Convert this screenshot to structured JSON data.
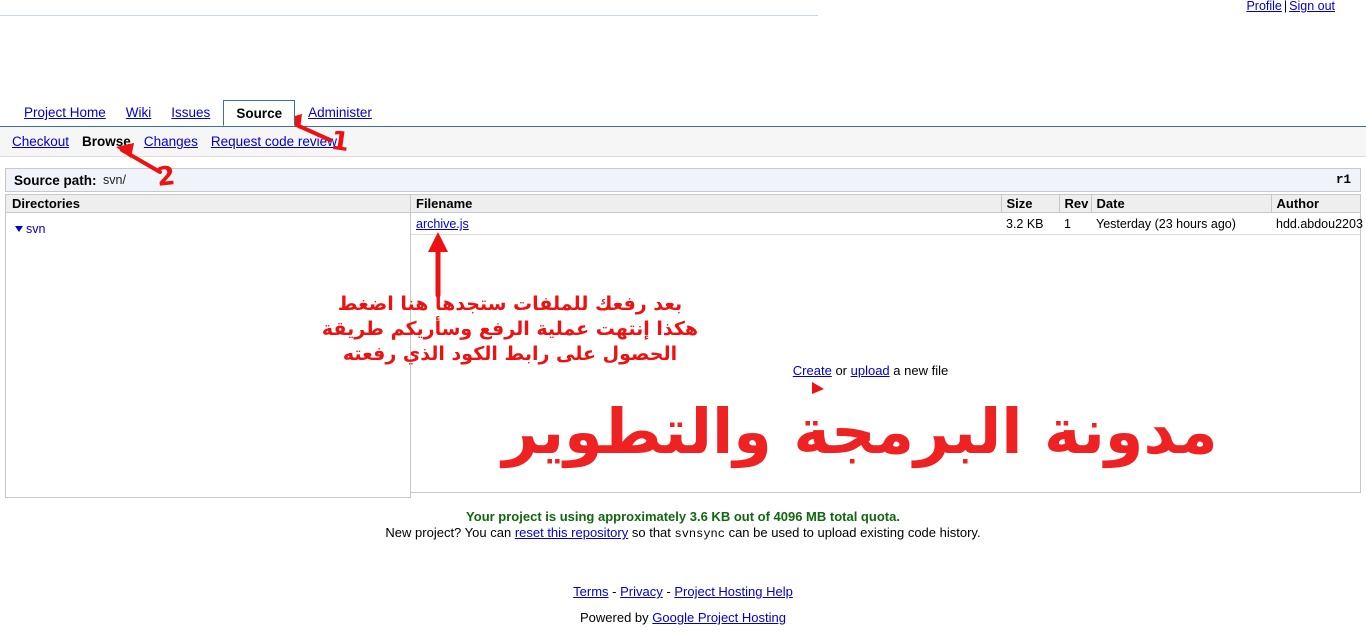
{
  "userbar": {
    "profile": "Profile",
    "separator": "|",
    "signout": "Sign out"
  },
  "tabs": [
    {
      "label": "Project Home",
      "selected": false
    },
    {
      "label": "Wiki",
      "selected": false
    },
    {
      "label": "Issues",
      "selected": false
    },
    {
      "label": "Source",
      "selected": true
    },
    {
      "label": "Administer",
      "selected": false
    }
  ],
  "subnav": {
    "items": [
      {
        "label": "Checkout",
        "current": false
      },
      {
        "label": "Browse",
        "current": true
      },
      {
        "label": "Changes",
        "current": false
      },
      {
        "label": "Request code review",
        "current": false
      }
    ]
  },
  "pathbar": {
    "label": "Source path:",
    "value": "svn/",
    "revision": "r1"
  },
  "directories": {
    "header": "Directories",
    "tree": [
      {
        "label": "svn",
        "expanded": true
      }
    ]
  },
  "files": {
    "columns": {
      "filename": "Filename",
      "size": "Size",
      "rev": "Rev",
      "date": "Date",
      "author": "Author"
    },
    "rows": [
      {
        "filename": "archive.js",
        "size": "3.2 KB",
        "rev": "1",
        "date": "Yesterday (23 hours ago)",
        "author": "hdd.abdou2203"
      }
    ]
  },
  "create_line": {
    "create": "Create",
    "or": "or",
    "upload": "upload",
    "suffix": "a new file"
  },
  "quota": {
    "text": "Your project is using approximately 3.6 KB out of 4096 MB total quota."
  },
  "new_project": {
    "prefix": "New project? You can",
    "link": "reset this repository",
    "middle": "so that",
    "code": "svnsync",
    "suffix": "can be used to upload existing code history."
  },
  "footer": {
    "terms": "Terms",
    "dash1": "-",
    "privacy": "Privacy",
    "dash2": "-",
    "help": "Project Hosting Help",
    "powered_prefix": "Powered by",
    "powered_link": "Google Project Hosting"
  },
  "annotations": {
    "marker_one": "1",
    "marker_two": "2",
    "arabic_lines": [
      "بعد رفعك للملفات ستجدها هنا اضغط",
      "هكذا إنتهت عملية الرفع وسأريكم طريقة",
      "الحصول على رابط الكود الذي رفعته"
    ],
    "watermark": "مدونة البرمجة والتطوير",
    "color": "#ee1111"
  }
}
